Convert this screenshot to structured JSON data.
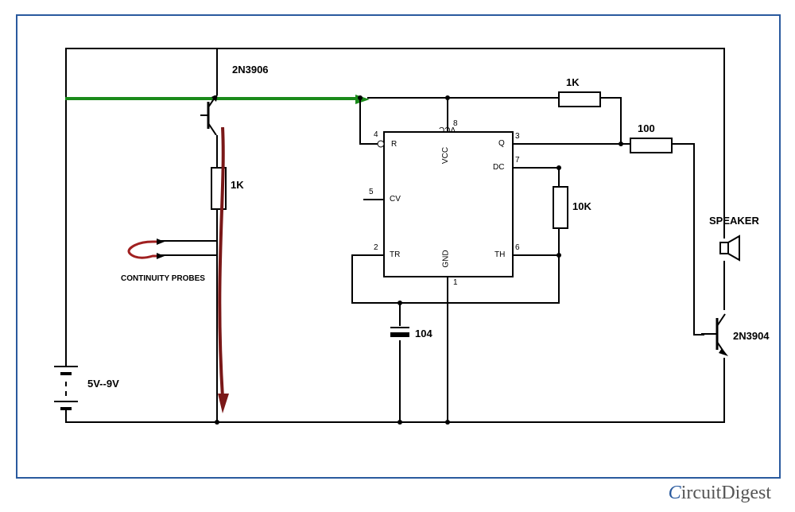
{
  "components": {
    "transistor_pnp": "2N3906",
    "transistor_npn": "2N3904",
    "resistor_base": "1K",
    "resistor_top": "1K",
    "resistor_dc": "10K",
    "resistor_out": "100",
    "capacitor": "104",
    "battery": "5V--9V",
    "speaker": "SPEAKER",
    "probes": "CONTINUITY PROBES"
  },
  "ic": {
    "pin1": "1",
    "pin2": "2",
    "pin3": "3",
    "pin4": "4",
    "pin5": "5",
    "pin6": "6",
    "pin7": "7",
    "pin8": "8",
    "lbl_r": "R",
    "lbl_vcc": "VCC",
    "lbl_q": "Q",
    "lbl_cv": "CV",
    "lbl_dc": "DC",
    "lbl_tr": "TR",
    "lbl_gnd": "GND",
    "lbl_th": "TH"
  },
  "logo": {
    "c": "C",
    "rest": "ircuitDigest"
  }
}
